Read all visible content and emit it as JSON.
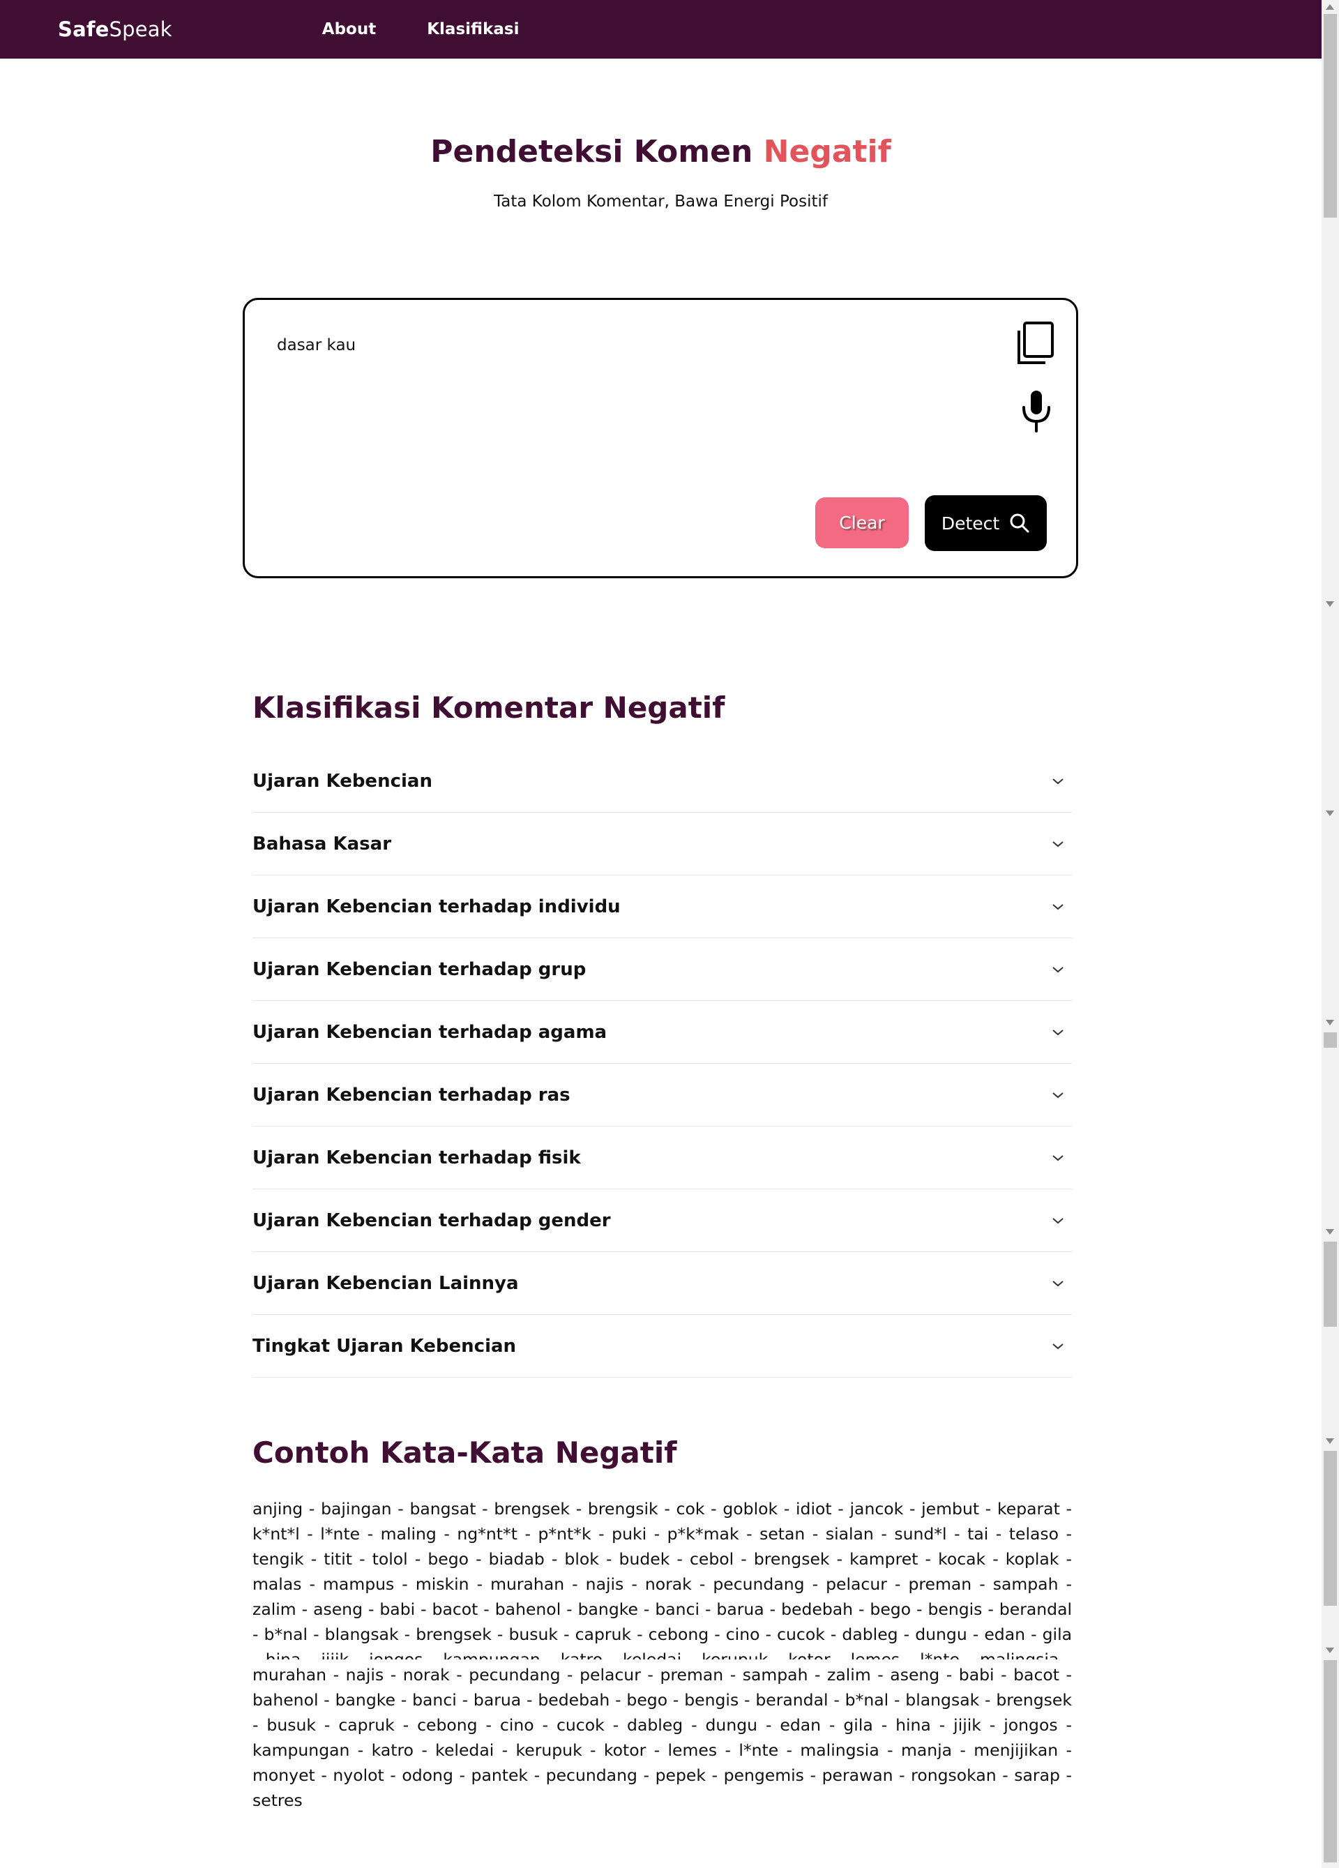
{
  "navbar": {
    "brand_bold": "Safe",
    "brand_light": "Speak",
    "links": [
      "About",
      "Klasifikasi"
    ]
  },
  "hero": {
    "title_main": "Pendeteksi Komen ",
    "title_accent": "Negatif",
    "subtitle": "Tata Kolom Komentar, Bawa Energi Positif"
  },
  "detector": {
    "input_value": "dasar kau",
    "clear_label": "Clear",
    "detect_label": "Detect"
  },
  "classification": {
    "title": "Klasifikasi Komentar Negatif",
    "items": [
      "Ujaran Kebencian",
      "Bahasa Kasar",
      "Ujaran Kebencian terhadap individu",
      "Ujaran Kebencian terhadap grup",
      "Ujaran Kebencian terhadap agama",
      "Ujaran Kebencian terhadap ras",
      "Ujaran Kebencian terhadap fisik",
      "Ujaran Kebencian terhadap gender",
      "Ujaran Kebencian Lainnya",
      "Tingkat Ujaran Kebencian"
    ]
  },
  "examples": {
    "title": "Contoh Kata-Kata Negatif",
    "words_first": "anjing - bajingan - bangsat - brengsek - brengsik - cok - goblok - idiot - jancok - jembut - keparat - k*nt*l - l*nte - maling - ng*nt*t - p*nt*k - puki - p*k*mak - setan - sialan - sund*l - tai - telaso - tengik - titit - tolol - bego - biadab - blok - budek - cebol - brengsek - kampret - kocak - koplak - malas - mampus - miskin - murahan - najis - norak - pecundang - pelacur - preman - sampah - zalim - aseng - babi - bacot - bahenol - bangke - banci - barua - bedebah - bego - bengis - berandal - b*nal - blangsak - brengsek - busuk - capruk - cebong - cino - cucok - dableg - dungu - edan - gila - hina - jijik - jongos - kampungan - katro - keledai - kerupuk - kotor - lemes - l*nte - malingsia - manja - menjijikan - monyet - nyolot - odong - pantek -",
    "words_second": "murahan - najis - norak - pecundang - pelacur - preman - sampah - zalim - aseng - babi - bacot - bahenol - bangke - banci - barua - bedebah - bego - bengis - berandal - b*nal - blangsak - brengsek - busuk - capruk - cebong - cino - cucok - dableg - dungu - edan - gila - hina - jijik - jongos - kampungan - katro - keledai - kerupuk - kotor - lemes - l*nte - malingsia - manja - menjijikan - monyet - nyolot - odong - pantek - pecundang - pepek - pengemis - perawan - rongsokan - sarap - setres"
  }
}
